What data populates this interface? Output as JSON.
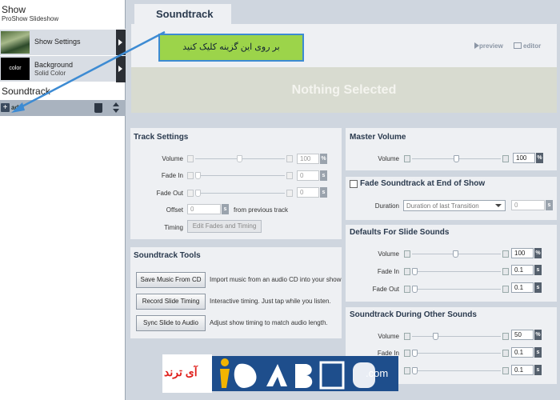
{
  "left": {
    "show_title": "Show",
    "show_subtitle": "ProShow Slideshow",
    "items": [
      {
        "label": "Show Settings",
        "sublabel": ""
      },
      {
        "label": "Background",
        "sublabel": "Solid Color",
        "thumb_text": "color"
      }
    ],
    "selected": "Soundtrack",
    "add_label": "add"
  },
  "tab": "Soundtrack",
  "header": {
    "preview": "preview",
    "editor": "editor"
  },
  "nothing_selected": "Nothing Selected",
  "callout": "بر روی این گزینه کلیک کنید",
  "track_settings": {
    "title": "Track Settings",
    "volume_label": "Volume",
    "volume_value": "100",
    "fade_in_label": "Fade In",
    "fade_in_value": "0",
    "fade_out_label": "Fade Out",
    "fade_out_value": "0",
    "offset_label": "Offset",
    "offset_value": "0",
    "offset_suffix": "from previous track",
    "timing_label": "Timing",
    "timing_button": "Edit Fades and Timing",
    "unit_percent": "%",
    "unit_seconds": "s"
  },
  "master_volume": {
    "title": "Master Volume",
    "volume_label": "Volume",
    "volume_value": "100"
  },
  "fade_end": {
    "title": "Fade Soundtrack at End of Show",
    "duration_label": "Duration",
    "duration_option": "Duration of last Transition",
    "duration_value": "0"
  },
  "defaults_slide": {
    "title": "Defaults For Slide Sounds",
    "volume_label": "Volume",
    "volume_value": "100",
    "fade_in_label": "Fade In",
    "fade_in_value": "0.1",
    "fade_out_label": "Fade Out",
    "fade_out_value": "0.1"
  },
  "tools": {
    "title": "Soundtrack Tools",
    "buttons": [
      {
        "label": "Save Music From CD",
        "desc": "Import music from an audio CD into your show"
      },
      {
        "label": "Record Slide Timing",
        "desc": "Interactive timing. Just tap while you listen."
      },
      {
        "label": "Sync Slide to Audio",
        "desc": "Adjust show timing to match audio length."
      }
    ]
  },
  "during_other": {
    "title": "Soundtrack During Other Sounds",
    "volume_label": "Volume",
    "volume_value": "50",
    "fade_in_label": "Fade In",
    "fade_in_value": "0.1",
    "fade_out_value": "0.1"
  },
  "watermark": {
    "text_fa": "آی ترند",
    "text_com": ".com"
  },
  "colors": {
    "accent_blue": "#3d8bd3",
    "callout_green": "#9cd44a",
    "panel_bg": "#eef0f3",
    "title_navy": "#2a3a4e"
  }
}
